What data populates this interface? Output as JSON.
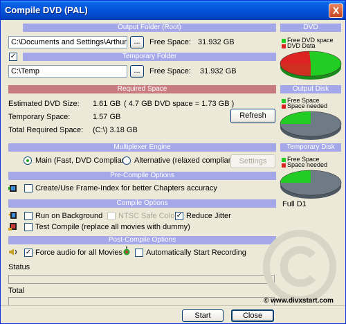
{
  "window": {
    "title": "Compile DVD (PAL)",
    "close_glyph": "X"
  },
  "output_folder": {
    "header": "Output Folder (Root)",
    "path": "C:\\Documents and Settings\\Arthur de Brui",
    "browse_label": "...",
    "free_label": "Free Space:",
    "free_value": "31.932 GB"
  },
  "temp_folder": {
    "checked": true,
    "header": "Temporary Folder",
    "path": "C:\\Temp",
    "browse_label": "...",
    "free_label": "Free Space:",
    "free_value": "31.932 GB"
  },
  "required_space": {
    "header": "Required Space",
    "rows": [
      {
        "label": "Estimated DVD Size:",
        "value": "1.61 GB",
        "extra": "( 4.7 GB DVD space = 1.73 GB )"
      },
      {
        "label": "Temporary Space:",
        "value": "1.57 GB",
        "extra": ""
      },
      {
        "label": "Total Required Space:",
        "value": "(C:\\) 3.18 GB",
        "extra": ""
      }
    ],
    "refresh_label": "Refresh"
  },
  "multiplexer": {
    "header": "Multiplexer Engine",
    "option_main": "Main (Fast, DVD Compliant)",
    "option_alt": "Alternative (relaxed compliancy)",
    "selected": "main",
    "settings_label": "Settings"
  },
  "pre_compile": {
    "header": "Pre-Compile Options",
    "frame_index_label": "Create/Use Frame-Index for better Chapters accuracy",
    "frame_index_checked": false
  },
  "compile_options": {
    "header": "Compile Options",
    "run_background_label": "Run on Background",
    "run_background_checked": false,
    "ntsc_label": "NTSC Safe Color",
    "ntsc_checked": false,
    "reduce_jitter_label": "Reduce Jitter",
    "reduce_jitter_checked": true,
    "test_compile_label": "Test Compile (replace all movies with dummy)",
    "test_compile_checked": false
  },
  "post_compile": {
    "header": "Post-Compile Options",
    "force_audio_label": "Force audio for all Movies",
    "force_audio_checked": true,
    "auto_record_label": "Automatically Start Recording",
    "auto_record_checked": false
  },
  "status": {
    "status_label": "Status",
    "total_label": "Total"
  },
  "buttons": {
    "start": "Start",
    "close": "Close"
  },
  "watermark": "© www.divxstart.com",
  "side": {
    "dvd": {
      "header": "DVD",
      "legend": [
        {
          "label": "Free DVD space",
          "color": "#22cc22"
        },
        {
          "label": "DVD Data",
          "color": "#dd2222"
        }
      ],
      "pie": {
        "free_fraction": 0.66,
        "used_fraction": 0.34
      }
    },
    "output_disk": {
      "header": "Output Disk",
      "legend": [
        {
          "label": "Free Space",
          "color": "#22cc22"
        },
        {
          "label": "Space needed",
          "color": "#dd2222"
        }
      ],
      "pie": {
        "free_fraction": 0.25,
        "used_fraction": 0.75
      }
    },
    "temp_disk": {
      "header": "Temporary Disk",
      "legend": [
        {
          "label": "Free Space",
          "color": "#22cc22"
        },
        {
          "label": "Space needed",
          "color": "#dd2222"
        }
      ],
      "pie": {
        "free_fraction": 0.25,
        "used_fraction": 0.75
      }
    },
    "format_label": "Full D1"
  },
  "colors": {
    "header_blue": "#a5a8e8",
    "header_red": "#c77b7f",
    "disk_gray": "#6e7a86"
  }
}
